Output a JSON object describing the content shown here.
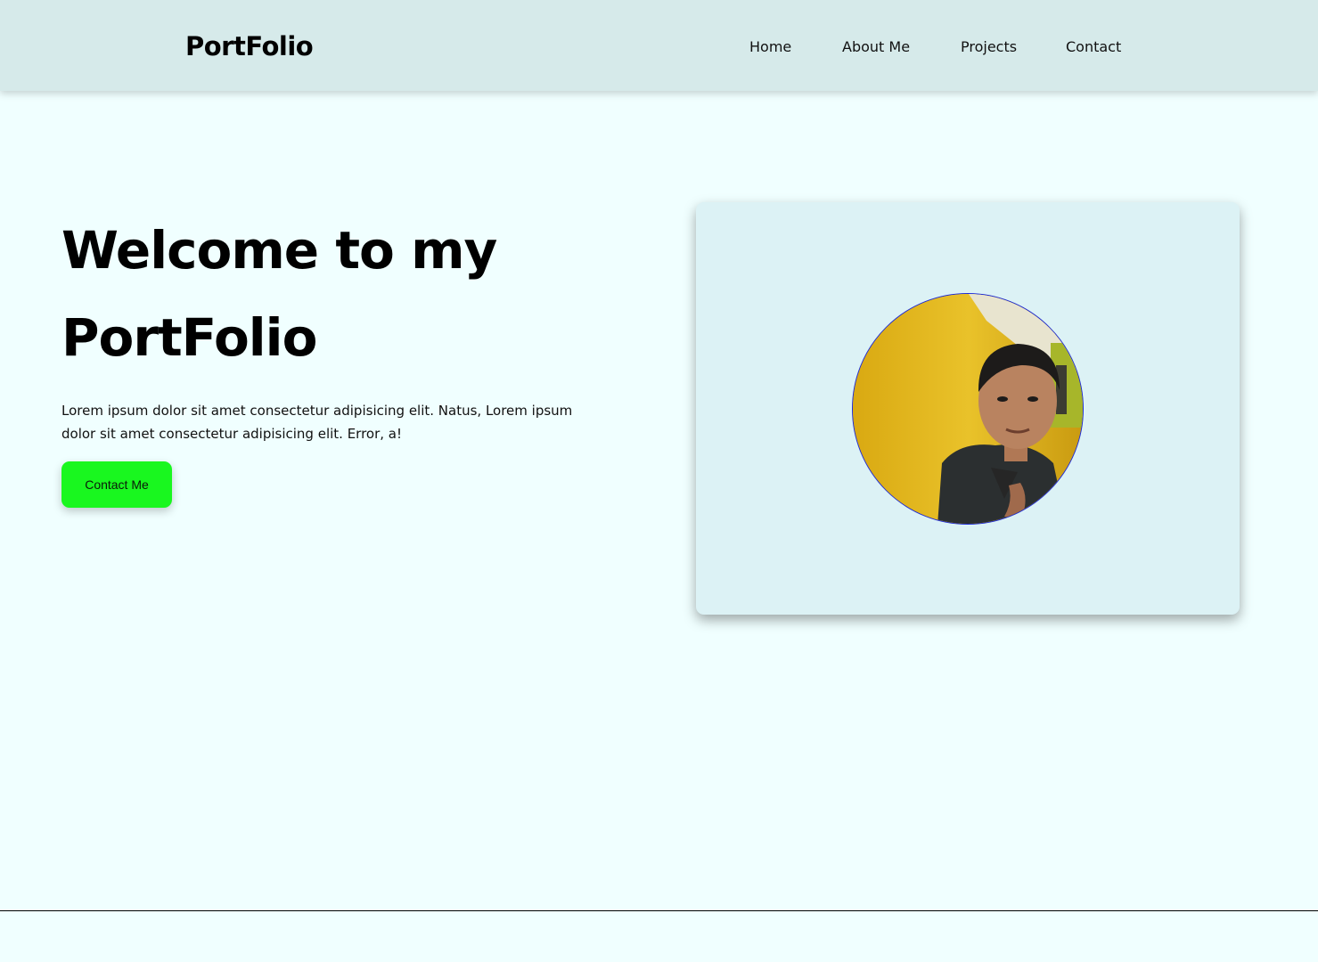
{
  "nav": {
    "brand": "PortFolio",
    "links": [
      "Home",
      "About Me",
      "Projects",
      "Contact"
    ]
  },
  "hero": {
    "title_line1": "Welcome to my",
    "title_line2": "PortFolio",
    "description": "Lorem ipsum dolor sit amet consectetur adipisicing elit. Natus, Lorem ipsum dolor sit amet consectetur adipisicing elit. Error, a!",
    "button_label": "Contact Me"
  },
  "colors": {
    "page_bg": "#f0ffff",
    "navbar_bg": "#d6eaea",
    "card_bg": "#dcf2f5",
    "button_bg": "#19f71f",
    "avatar_border": "#1e2bd6"
  }
}
